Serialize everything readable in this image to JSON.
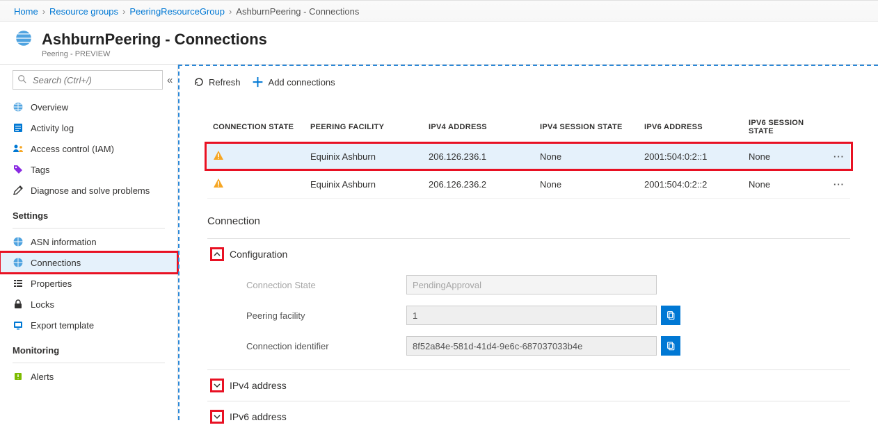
{
  "breadcrumb": {
    "home": "Home",
    "rg": "Resource groups",
    "group": "PeeringResourceGroup",
    "current": "AshburnPeering - Connections"
  },
  "header": {
    "title": "AshburnPeering - Connections",
    "subtitle": "Peering - PREVIEW"
  },
  "search": {
    "placeholder": "Search (Ctrl+/)"
  },
  "nav": {
    "overview": "Overview",
    "activity": "Activity log",
    "iam": "Access control (IAM)",
    "tags": "Tags",
    "diagnose": "Diagnose and solve problems",
    "settings_section": "Settings",
    "asn": "ASN information",
    "connections": "Connections",
    "properties": "Properties",
    "locks": "Locks",
    "export": "Export template",
    "monitoring_section": "Monitoring",
    "alerts": "Alerts"
  },
  "toolbar": {
    "refresh": "Refresh",
    "add": "Add connections"
  },
  "table": {
    "cols": {
      "state": "CONNECTION STATE",
      "facility": "PEERING FACILITY",
      "ipv4": "IPV4 ADDRESS",
      "ipv4s": "IPV4 SESSION STATE",
      "ipv6": "IPV6 ADDRESS",
      "ipv6s": "IPV6 SESSION STATE"
    },
    "rows": [
      {
        "facility": "Equinix Ashburn",
        "ipv4": "206.126.236.1",
        "ipv4s": "None",
        "ipv6": "2001:504:0:2::1",
        "ipv6s": "None"
      },
      {
        "facility": "Equinix Ashburn",
        "ipv4": "206.126.236.2",
        "ipv4s": "None",
        "ipv6": "2001:504:0:2::2",
        "ipv6s": "None"
      }
    ]
  },
  "connection": {
    "title": "Connection",
    "config_label": "Configuration",
    "fields": {
      "state_label": "Connection State",
      "state_value": "PendingApproval",
      "facility_label": "Peering facility",
      "facility_value": "1",
      "identifier_label": "Connection identifier",
      "identifier_value": "8f52a84e-581d-41d4-9e6c-687037033b4e"
    },
    "ipv4_label": "IPv4 address",
    "ipv6_label": "IPv6 address"
  }
}
